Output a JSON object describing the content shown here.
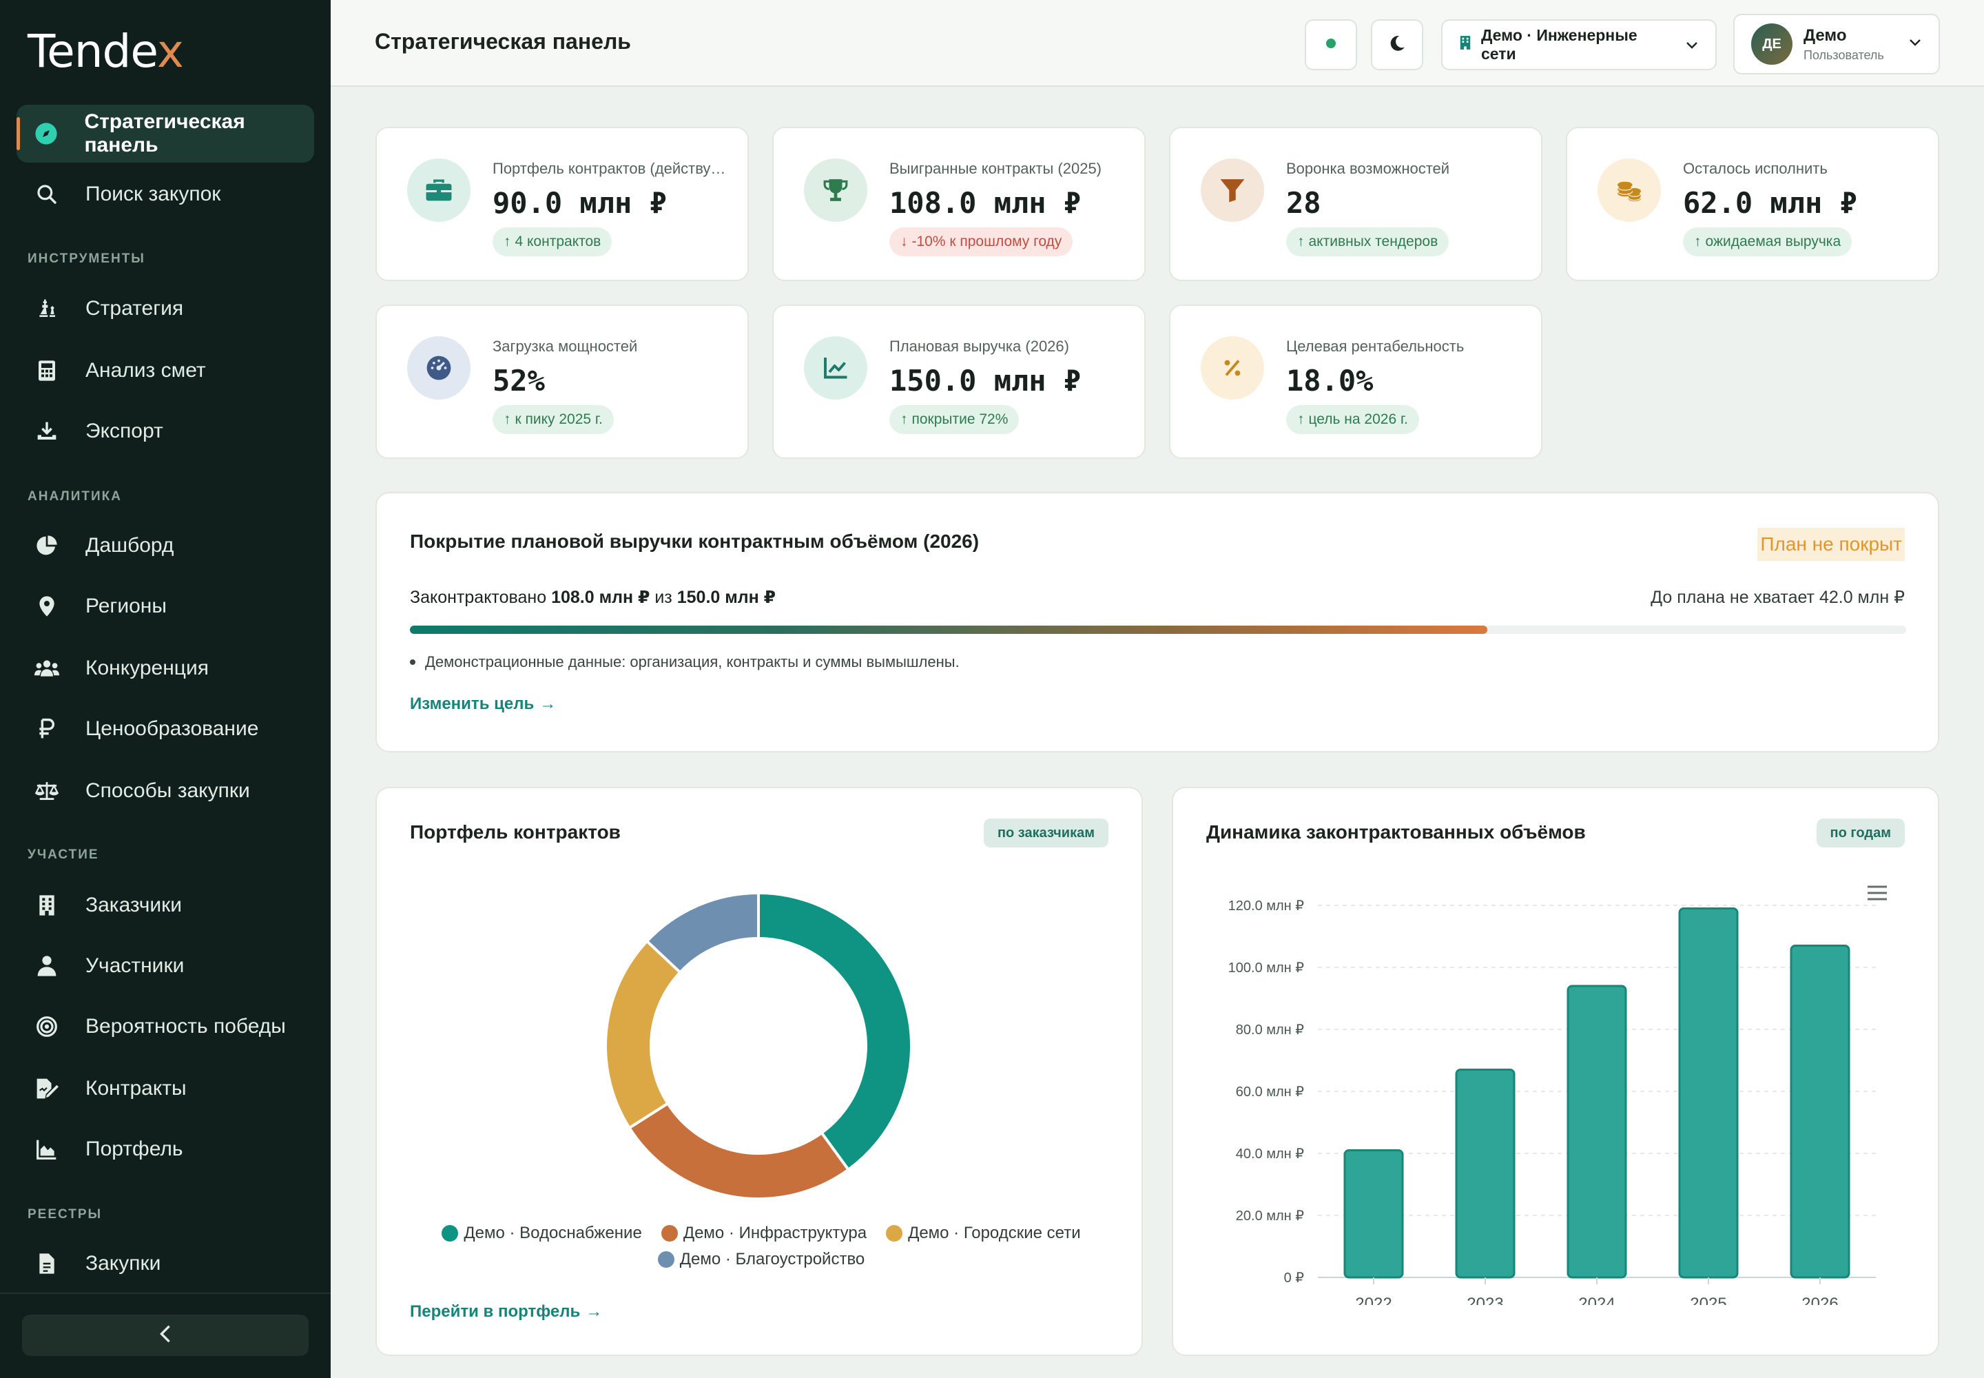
{
  "brand": {
    "name_main": "Tende",
    "name_accent": "x"
  },
  "sidebar": {
    "active": {
      "label": "Стратегическая панель",
      "icon": "compass-icon"
    },
    "top_items": [
      {
        "label": "Поиск закупок",
        "icon": "search-icon"
      }
    ],
    "sections": [
      {
        "title": "ИНСТРУМЕНТЫ",
        "items": [
          {
            "label": "Стратегия",
            "icon": "chess-icon"
          },
          {
            "label": "Анализ смет",
            "icon": "calculator-icon"
          },
          {
            "label": "Экспорт",
            "icon": "download-icon"
          }
        ]
      },
      {
        "title": "АНАЛИТИКА",
        "items": [
          {
            "label": "Дашборд",
            "icon": "pie-chart-icon"
          },
          {
            "label": "Регионы",
            "icon": "map-pin-icon"
          },
          {
            "label": "Конкуренция",
            "icon": "users-icon"
          },
          {
            "label": "Ценообразование",
            "icon": "ruble-icon"
          },
          {
            "label": "Способы закупки",
            "icon": "scales-icon"
          }
        ]
      },
      {
        "title": "УЧАСТИЕ",
        "items": [
          {
            "label": "Заказчики",
            "icon": "building-icon"
          },
          {
            "label": "Участники",
            "icon": "user-icon"
          },
          {
            "label": "Вероятность победы",
            "icon": "target-icon"
          },
          {
            "label": "Контракты",
            "icon": "contract-icon"
          },
          {
            "label": "Портфель",
            "icon": "area-chart-icon"
          }
        ]
      },
      {
        "title": "РЕЕСТРЫ",
        "items": [
          {
            "label": "Закупки",
            "icon": "file-icon"
          }
        ]
      }
    ]
  },
  "header": {
    "title": "Стратегическая панель",
    "org": "Демо · Инженерные сети",
    "user": {
      "initials": "ДЕ",
      "name": "Демо",
      "role": "Пользователь"
    }
  },
  "kpis": [
    {
      "label": "Портфель контрактов (действующие)",
      "value": "90.0 млн ₽",
      "badge": "4 контрактов",
      "trend": "up",
      "icon": "briefcase-icon",
      "color": "#1d8a77",
      "bg": "#dcefe9"
    },
    {
      "label": "Выигранные контракты (2025)",
      "value": "108.0 млн ₽",
      "badge": "-10% к прошлому году",
      "trend": "down",
      "icon": "trophy-icon",
      "color": "#2f7a4f",
      "bg": "#e0efe5"
    },
    {
      "label": "Воронка возможностей",
      "value": "28",
      "badge": "активных тендеров",
      "trend": "up",
      "icon": "funnel-icon",
      "color": "#a5561c",
      "bg": "#f5e6da"
    },
    {
      "label": "Осталось исполнить",
      "value": "62.0 млн ₽",
      "badge": "ожидаемая выручка",
      "trend": "up",
      "icon": "coins-icon",
      "color": "#c8891c",
      "bg": "#fbefd9"
    },
    {
      "label": "Загрузка мощностей",
      "value": "52%",
      "badge": "к пику 2025 г.",
      "trend": "up",
      "icon": "gauge-icon",
      "color": "#3f5a86",
      "bg": "#e2e8f1"
    },
    {
      "label": "Плановая выручка (2026)",
      "value": "150.0 млн ₽",
      "badge": "покрытие 72%",
      "trend": "up",
      "icon": "line-chart-icon",
      "color": "#1d7a6a",
      "bg": "#dcefe9"
    },
    {
      "label": "Целевая рентабельность",
      "value": "18.0%",
      "badge": "цель на 2026 г.",
      "trend": "up",
      "icon": "percent-icon",
      "color": "#c8891c",
      "bg": "#fbefd9"
    }
  ],
  "coverage": {
    "title": "Покрытие плановой выручки контрактным объёмом (2026)",
    "status": "План не покрыт",
    "text_prefix": "Законтрактовано",
    "contracted": "108.0 млн ₽",
    "text_middle": "из",
    "plan": "150.0 млн ₽",
    "gap": "До плана не хватает 42.0 млн ₽",
    "progress": 0.72,
    "note": "Демонстрационные данные: организация, контракты и суммы вымышлены.",
    "link": "Изменить цель",
    "status_color": "#e0962f"
  },
  "portfolio": {
    "title": "Портфель контрактов",
    "pill": "по заказчикам",
    "link": "Перейти в портфель"
  },
  "dynamics": {
    "title": "Динамика законтрактованных объёмов",
    "pill": "по годам"
  },
  "chart_data": [
    {
      "type": "pie",
      "donut": true,
      "title": "Портфель контрактов",
      "categories": [
        "Демо · Водоснабжение",
        "Демо · Инфраструктура",
        "Демо · Городские сети",
        "Демо · Благоустройство"
      ],
      "values": [
        40,
        26,
        21,
        13
      ],
      "colors": [
        "#0f9484",
        "#c8703c",
        "#dca745",
        "#6e8fb0"
      ],
      "legend": "bottom"
    },
    {
      "type": "bar",
      "title": "Динамика законтрактованных объёмов",
      "categories": [
        "2022",
        "2023",
        "2024",
        "2025",
        "2026"
      ],
      "values": [
        41,
        67,
        94,
        119,
        107
      ],
      "unit": "млн ₽",
      "ylim": [
        0,
        120
      ],
      "yticks": [
        "0 ₽",
        "20.0 млн ₽",
        "40.0 млн ₽",
        "60.0 млн ₽",
        "80.0 млн ₽",
        "100.0 млн ₽",
        "120.0 млн ₽"
      ],
      "grid": true,
      "color": "#2ea597"
    }
  ]
}
